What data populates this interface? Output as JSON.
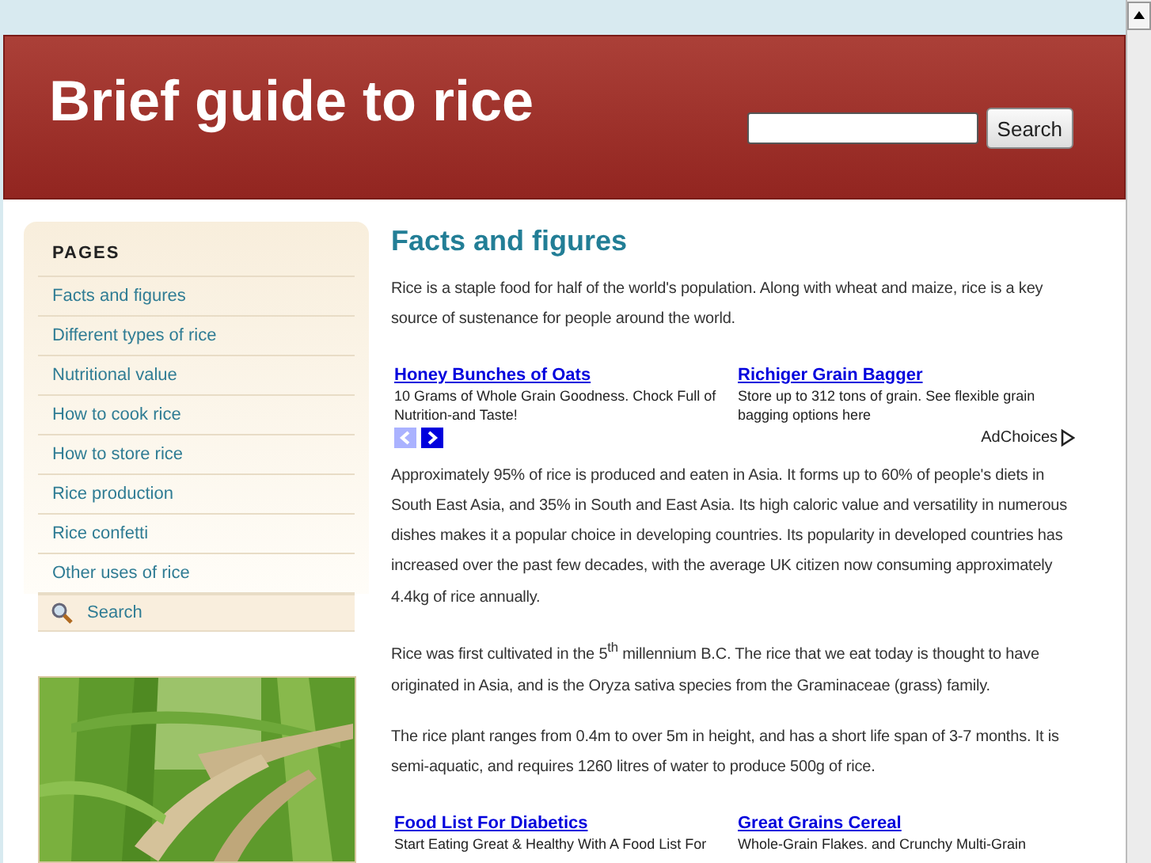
{
  "header": {
    "title": "Brief guide to rice",
    "search": {
      "button": "Search"
    }
  },
  "sidebar": {
    "heading": "PAGES",
    "items": [
      {
        "label": "Facts and figures"
      },
      {
        "label": "Different types of rice"
      },
      {
        "label": "Nutritional value"
      },
      {
        "label": "How to cook rice"
      },
      {
        "label": "How to store rice"
      },
      {
        "label": "Rice production"
      },
      {
        "label": "Rice confetti"
      },
      {
        "label": "Other uses of rice"
      }
    ],
    "search_link": "Search"
  },
  "content": {
    "heading": "Facts and figures",
    "blocks": [
      {
        "kind": "text",
        "text": "Rice is a staple food for half of the world's population.  Along with wheat and maize, rice is a key source of sustenance for people around the world."
      },
      {
        "kind": "ads",
        "ads": [
          {
            "title": "Honey Bunches of Oats",
            "text": "10 Grams of Whole Grain Goodness. Chock Full of Nutrition-and Taste!"
          },
          {
            "title": "Richiger Grain Bagger",
            "text": "Store up to 312 tons of grain. See flexible grain bagging options here"
          }
        ],
        "nav": {
          "prev_disabled": true,
          "next_disabled": false
        },
        "adchoices": "AdChoices"
      },
      {
        "kind": "text",
        "text": "Approximately 95% of rice is produced and eaten in Asia.  It forms up to 60% of people's diets in South East Asia, and 35% in South and East Asia.  Its high caloric value and versatility in numerous dishes makes it a popular choice in developing countries.  Its popularity in developed countries has increased over the past few decades, with the average UK citizen now consuming approximately 4.4kg of rice annually."
      },
      {
        "kind": "text",
        "text": "Rice was first cultivated in the 5$^{th}$ millennium B.C.  The rice that we eat today is thought to have originated in Asia, and is the Oryza sativa species from the Graminaceae (grass) family."
      },
      {
        "kind": "text",
        "text": "The rice plant ranges from 0.4m to over 5m in height, and has a short life span of 3-7 months.  It is semi-aquatic, and requires 1260 litres of water to produce 500g of rice."
      },
      {
        "kind": "ads",
        "ads": [
          {
            "title": "Food List For Diabetics",
            "text": "Start Eating Great & Healthy With A Food List For"
          },
          {
            "title": "Great Grains Cereal",
            "text": "Whole-Grain Flakes. and Crunchy Multi-Grain"
          }
        ]
      }
    ]
  }
}
